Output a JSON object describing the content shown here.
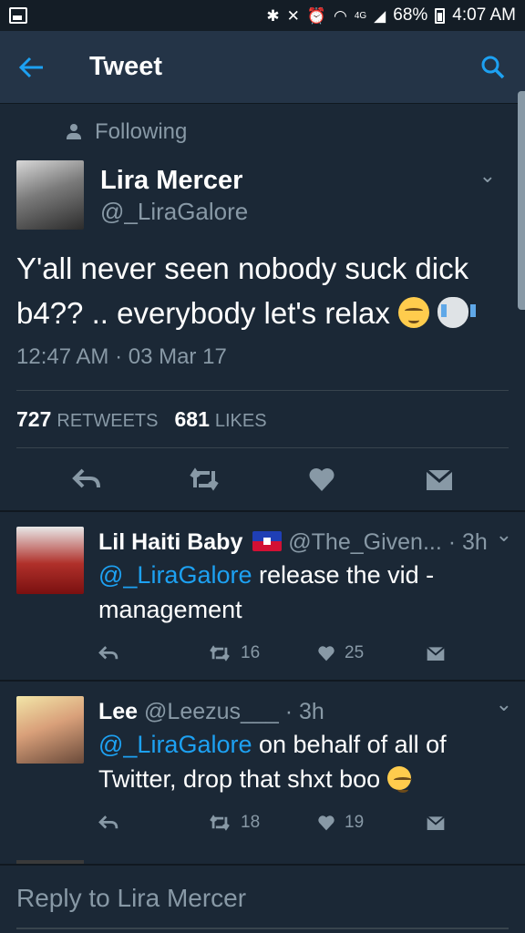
{
  "status_bar": {
    "network": "4G",
    "battery": "68%",
    "time": "4:07 AM"
  },
  "header": {
    "title": "Tweet"
  },
  "tweet": {
    "context": "Following",
    "author_name": "Lira Mercer",
    "author_handle": "@_LiraGalore",
    "text_line1": "Y'all never seen nobody suck dick",
    "text_line2": "b4?? .. everybody let's relax",
    "timestamp": "12:47 AM · 03 Mar 17",
    "retweets_count": "727",
    "retweets_label": "RETWEETS",
    "likes_count": "681",
    "likes_label": "LIKES"
  },
  "replies": [
    {
      "name": "Lil Haiti Baby",
      "handle": "@The_Given...",
      "age": "· 3h",
      "mention": "@_LiraGalore",
      "text_line1": " release the vid -",
      "text_line2": "management",
      "retweets": "16",
      "likes": "25"
    },
    {
      "name": "Lee",
      "handle": "@Leezus___",
      "age": "· 3h",
      "mention": "@_LiraGalore",
      "text_line1": " on behalf of all of",
      "text_line2": "Twitter, drop that shxt boo",
      "retweets": "18",
      "likes": "19"
    }
  ],
  "composer": {
    "placeholder": "Reply to Lira Mercer"
  },
  "colors": {
    "background": "#1b2836",
    "app_bar": "#243447",
    "accent": "#1da1f2",
    "secondary_text": "#8899a6"
  },
  "icons": [
    "image-icon",
    "bluetooth-icon",
    "mute-icon",
    "alarm-icon",
    "wifi-icon",
    "signal-icon",
    "battery-icon",
    "back-arrow-icon",
    "search-icon",
    "person-icon",
    "chevron-down-icon",
    "reply-icon",
    "retweet-icon",
    "like-icon",
    "direct-message-icon"
  ]
}
